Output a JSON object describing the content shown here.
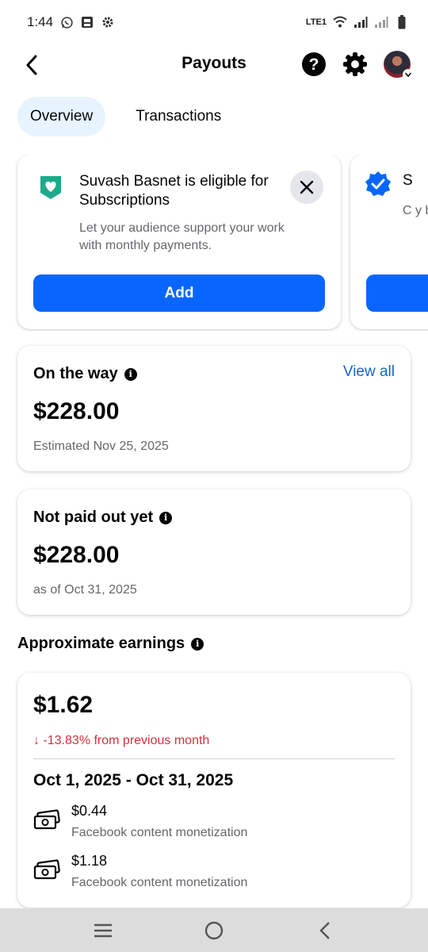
{
  "status": {
    "time": "1:44",
    "network": "LTE1"
  },
  "header": {
    "title": "Payouts"
  },
  "tabs": [
    {
      "label": "Overview",
      "active": true
    },
    {
      "label": "Transactions",
      "active": false
    }
  ],
  "promo": {
    "title": "Suvash Basnet is eligible for Subscriptions",
    "body": "Let your audience support your work with monthly payments.",
    "button": "Add",
    "next_title_peek": "S",
    "next_body_peek": "C y b a"
  },
  "on_the_way": {
    "title": "On the way",
    "link": "View all",
    "amount": "$228.00",
    "note": "Estimated Nov 25, 2025"
  },
  "not_paid": {
    "title": "Not paid out yet",
    "amount": "$228.00",
    "note": "as of Oct 31, 2025"
  },
  "earnings": {
    "section_title": "Approximate earnings",
    "amount": "$1.62",
    "change": "↓ -13.83% from previous month",
    "range": "Oct 1, 2025 - Oct 31, 2025",
    "items": [
      {
        "value": "$0.44",
        "source": "Facebook content monetization"
      },
      {
        "value": "$1.18",
        "source": "Facebook content monetization"
      }
    ]
  },
  "colors": {
    "accent": "#0866ff",
    "link": "#1666c5",
    "negative": "#d6313c",
    "tab_active_bg": "#e7f3ff"
  }
}
